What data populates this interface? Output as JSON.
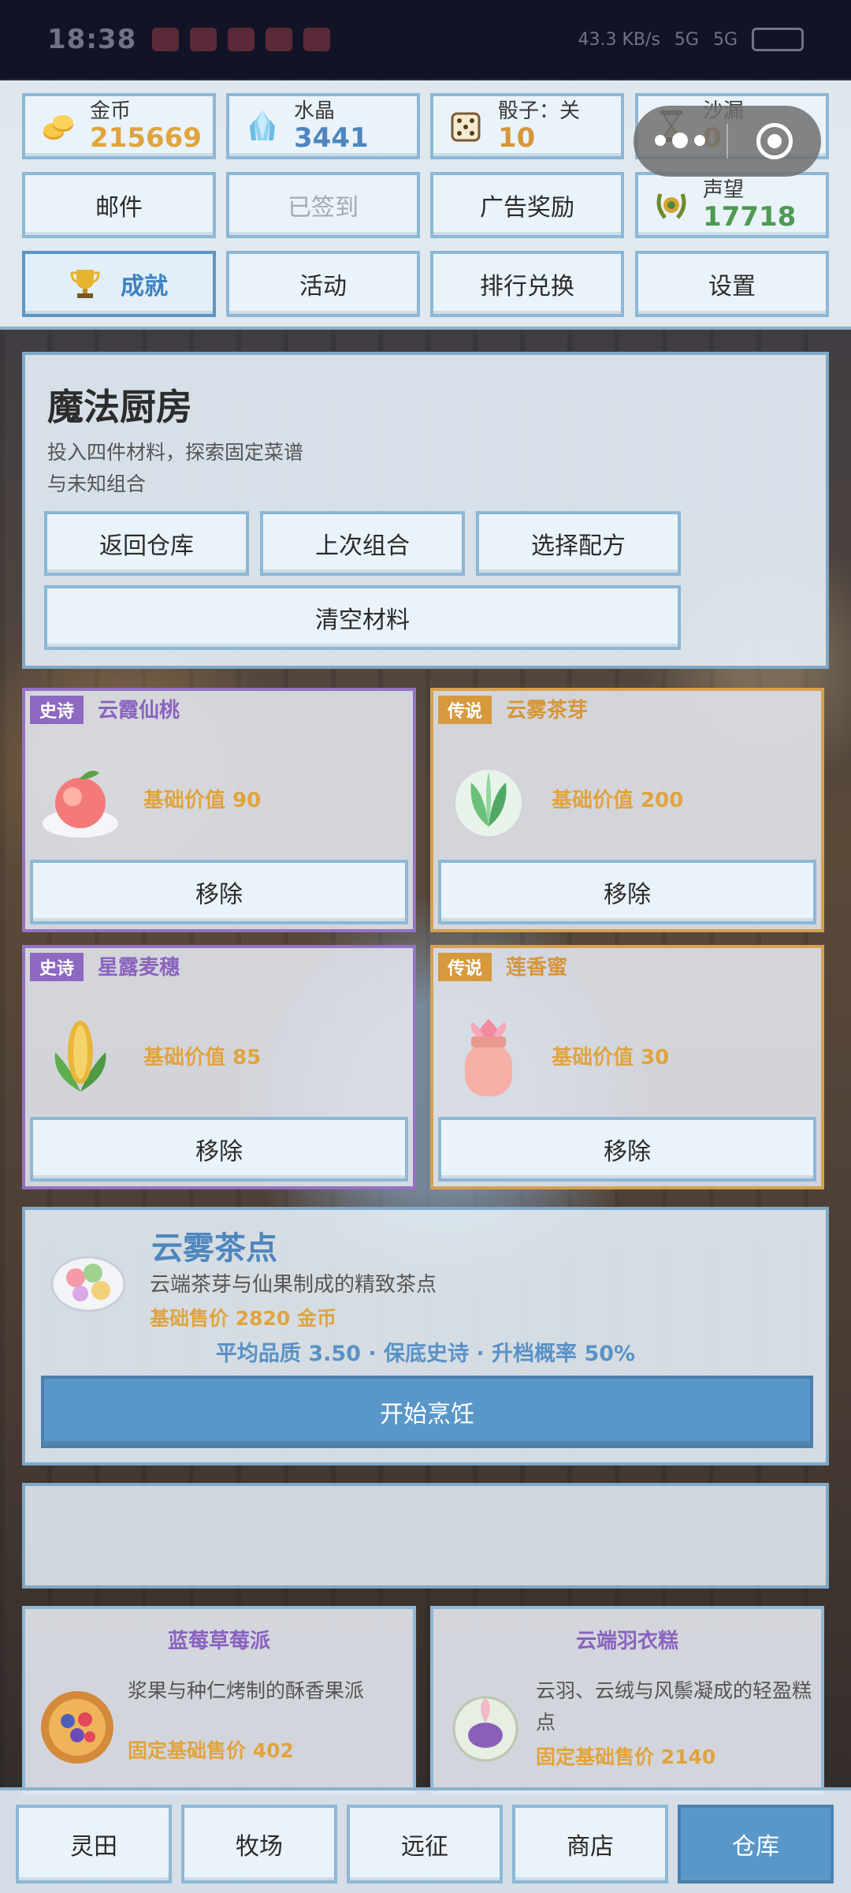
{
  "status": {
    "time": "18:38",
    "net": "43.3 KB/s",
    "sig1": "5G",
    "sig2": "5G"
  },
  "resources": {
    "gold": {
      "label": "金币",
      "value": "215669",
      "color": "#e0a43e"
    },
    "crystal": {
      "label": "水晶",
      "value": "3441",
      "color": "#4e86bd"
    },
    "dice": {
      "label": "骰子：关",
      "value": "10",
      "color": "#d6963a"
    },
    "hourglass": {
      "label": "沙漏",
      "value": "0",
      "color": "#d6963a"
    },
    "reputation": {
      "label": "声望",
      "value": "17718",
      "color": "#4f9a52"
    }
  },
  "menu": {
    "mail": "邮件",
    "signed": "已签到",
    "ad_reward": "广告奖励",
    "achievement": "成就",
    "activity": "活动",
    "rank_exchange": "排行兑换",
    "settings": "设置"
  },
  "kitchen": {
    "title": "魔法厨房",
    "description": "投入四件材料，探索固定菜谱与未知组合",
    "buttons": {
      "back": "返回仓库",
      "last": "上次组合",
      "choose": "选择配方",
      "clear": "清空材料"
    }
  },
  "ingredients": [
    {
      "rarity": "史诗",
      "name": "云霞仙桃",
      "price": "基础价值 90",
      "icon": "peach-icon",
      "remove": "移除"
    },
    {
      "rarity": "传说",
      "name": "云雾茶芽",
      "price": "基础价值 200",
      "icon": "tea-sprout-icon",
      "remove": "移除"
    },
    {
      "rarity": "史诗",
      "name": "星露麦穗",
      "price": "基础价值 85",
      "icon": "wheat-icon",
      "remove": "移除"
    },
    {
      "rarity": "传说",
      "name": "莲香蜜",
      "price": "基础价值 30",
      "icon": "honey-jar-icon",
      "remove": "移除"
    }
  ],
  "result": {
    "name": "云雾茶点",
    "description": "云端茶芽与仙果制成的精致茶点",
    "price": "基础售价 2820 金币",
    "stats": "平均品质 3.50 · 保底史诗 · 升档概率 50%",
    "cook": "开始烹饪"
  },
  "recipes": [
    {
      "title": "蓝莓草莓派",
      "description": "浆果与种仁烤制的酥香果派",
      "price": "固定基础售价 402"
    },
    {
      "title": "云端羽衣糕",
      "description": "云羽、云绒与风鬃凝成的轻盈糕点",
      "price": "固定基础售价 2140"
    }
  ],
  "nav": {
    "field": "灵田",
    "ranch": "牧场",
    "expedition": "远征",
    "shop": "商店",
    "warehouse": "仓库"
  }
}
